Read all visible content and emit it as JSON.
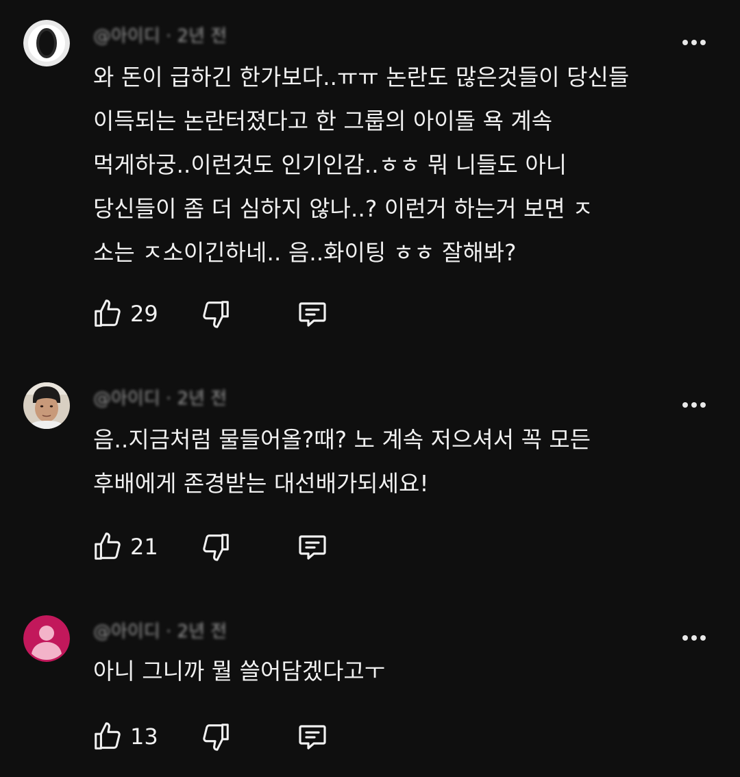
{
  "comments": [
    {
      "handle": "@아이디 · 2년 전",
      "avatar": "ring-avatar",
      "lines": [
        "와 돈이 급하긴 한가보다..ㅠㅠ 논란도 많은것들이 당신들",
        "이득되는 논란터졌다고 한 그룹의 아이돌 욕 계속",
        "먹게하궁..이런것도 인기인감..ㅎㅎ 뭐 니들도 아니",
        "당신들이 좀 더 심하지 않나..? 이런거 하는거 보면 ㅈ",
        "소는 ㅈ소이긴하네.. 음..화이팅 ㅎㅎ 잘해봐?"
      ],
      "likes": "29"
    },
    {
      "handle": "@아이디 · 2년 전",
      "avatar": "photo-avatar",
      "lines": [
        "음..지금처럼 물들어올?때? 노 계속 저으셔서 꼭 모든",
        "후배에게 존경받는 대선배가되세요!"
      ],
      "likes": "21"
    },
    {
      "handle": "@아이디 · 2년 전",
      "avatar": "default-user-avatar",
      "lines": [
        "아니 그니까 뭘 쓸어담겠다고ㅜ"
      ],
      "likes": "13"
    }
  ],
  "colors": {
    "background": "#0f0f0f",
    "text": "#f1f1f1",
    "handle": "#9a9a9a",
    "avatar_pink": "#c2185b",
    "avatar_pink_figure": "#f3b3c9"
  }
}
